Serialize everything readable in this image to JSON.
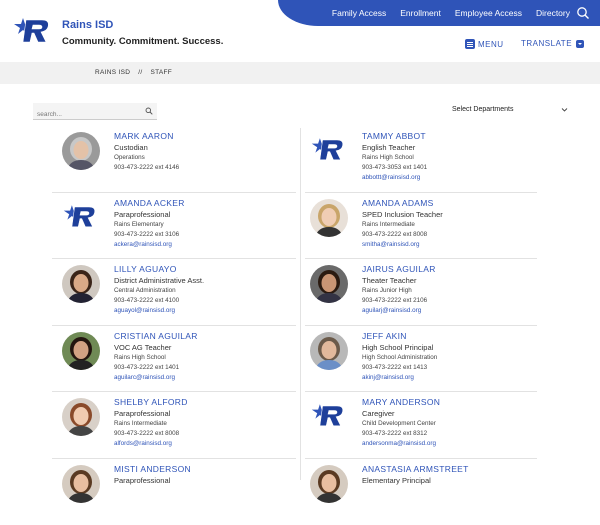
{
  "site": {
    "name": "Rains ISD",
    "tagline": "Community. Commitment. Success."
  },
  "topnav": [
    "Family Access",
    "Enrollment",
    "Employee Access",
    "Directory"
  ],
  "menu_label": "MENU",
  "translate_label": "TRANSLATE",
  "breadcrumb": [
    "RAINS ISD",
    "//",
    "STAFF"
  ],
  "search": {
    "placeholder": "search..."
  },
  "department_select": "Select Departments",
  "colors": {
    "brand": "#2f54b8",
    "text": "#333333"
  },
  "staff": [
    {
      "name": "MARK AARON",
      "title": "Custodian",
      "location": "Operations",
      "phone": "903-473-2222 ext 4146",
      "email": "",
      "photo": "photo-gray-hair"
    },
    {
      "name": "TAMMY ABBOT",
      "title": "English Teacher",
      "location": "Rains High School",
      "phone": "903-473-3053 ext 1401",
      "email": "abbottt@rainsisd.org",
      "photo": "logo"
    },
    {
      "name": "AMANDA ACKER",
      "title": "Paraprofessional",
      "location": "Rains Elementary",
      "phone": "903-473-2222 ext 3106",
      "email": "ackera@rainsisd.org",
      "photo": "logo"
    },
    {
      "name": "AMANDA ADAMS",
      "title": "SPED Inclusion Teacher",
      "location": "Rains Intermediate",
      "phone": "903-473-2222 ext 8008",
      "email": "smitha@rainsisd.org",
      "photo": "photo-blonde"
    },
    {
      "name": "LILLY AGUAYO",
      "title": "District Administrative Asst.",
      "location": "Central Administration",
      "phone": "903-473-2222 ext 4100",
      "email": "aguayol@rainsisd.org",
      "photo": "photo-dark-hair"
    },
    {
      "name": "JAIRUS AGUILAR",
      "title": "Theater Teacher",
      "location": "Rains Junior High",
      "phone": "903-473-2222 ext 2106",
      "email": "aguilarj@rainsisd.org",
      "photo": "photo-beard"
    },
    {
      "name": "CRISTIAN AGUILAR",
      "title": "VOC AG Teacher",
      "location": "Rains High School",
      "phone": "903-473-2222 ext 1401",
      "email": "aguilarc@rainsisd.org",
      "photo": "photo-dark-hair-green"
    },
    {
      "name": "JEFF AKIN",
      "title": "High School Principal",
      "location": "High School Administration",
      "phone": "903-473-2222 ext 1413",
      "email": "akinj@rainsisd.org",
      "photo": "photo-man-glasses"
    },
    {
      "name": "SHELBY ALFORD",
      "title": "Paraprofessional",
      "location": "Rains Intermediate",
      "phone": "903-473-2222 ext 8008",
      "email": "alfords@rainsisd.org",
      "photo": "photo-auburn"
    },
    {
      "name": "MARY ANDERSON",
      "title": "Caregiver",
      "location": "Child Development Center",
      "phone": "903-473-2222 ext 8312",
      "email": "andersonma@rainsisd.org",
      "photo": "logo"
    },
    {
      "name": "MISTI ANDERSON",
      "title": "Paraprofessional",
      "location": "",
      "phone": "",
      "email": "",
      "photo": "photo-brown-hair"
    },
    {
      "name": "ANASTASIA ARMSTREET",
      "title": "Elementary Principal",
      "location": "",
      "phone": "",
      "email": "",
      "photo": "photo-brown-hair"
    }
  ]
}
